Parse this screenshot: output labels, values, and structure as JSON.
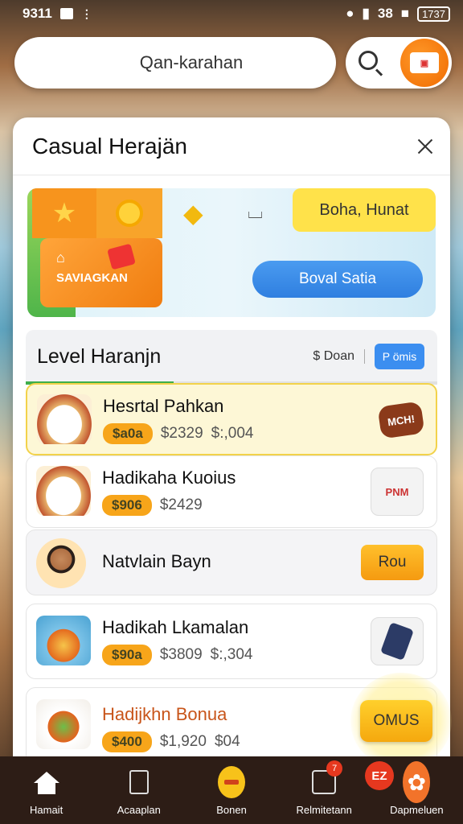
{
  "status_bar": {
    "time": "9311",
    "signal": "38",
    "battery": "1737"
  },
  "search": {
    "placeholder": "Qan-karahan"
  },
  "panel": {
    "title": "Casual Herajän"
  },
  "banner": {
    "promo_label": "Boha, Hunat",
    "sub_label": "SAVIAGKAN",
    "cta_label": "Boval Satia"
  },
  "level": {
    "title": "Level Haranjn",
    "amount": "$ Doan",
    "button_label": "P ömis",
    "progress": 0.36
  },
  "items": [
    {
      "name": "Hesrtal Pahkan",
      "badge": "$a0a",
      "price1": "$2329",
      "price2": "$:,004",
      "side": "MCH!"
    },
    {
      "name": "Hadikaha Kuoius",
      "badge": "$906",
      "price1": "$2429",
      "price2": "",
      "side": "PNM"
    },
    {
      "name": "Natvlain Bayn",
      "button_label": "Rou"
    },
    {
      "name": "Hadikah Lkamalan",
      "badge": "$90a",
      "price1": "$3809",
      "price2": "$:,304"
    },
    {
      "name": "Hadijkhn Bonua",
      "badge": "$400",
      "price1": "$1,920",
      "price2": "$04"
    }
  ],
  "fab": {
    "label": "OMUS"
  },
  "nav": {
    "items": [
      {
        "label": "Hamait"
      },
      {
        "label": "Acaaplan"
      },
      {
        "label": "Bonen"
      },
      {
        "label": "Relmitetann"
      },
      {
        "label": "Dapmeluen"
      }
    ],
    "badge_ez": "EZ",
    "badge_count": "7"
  }
}
